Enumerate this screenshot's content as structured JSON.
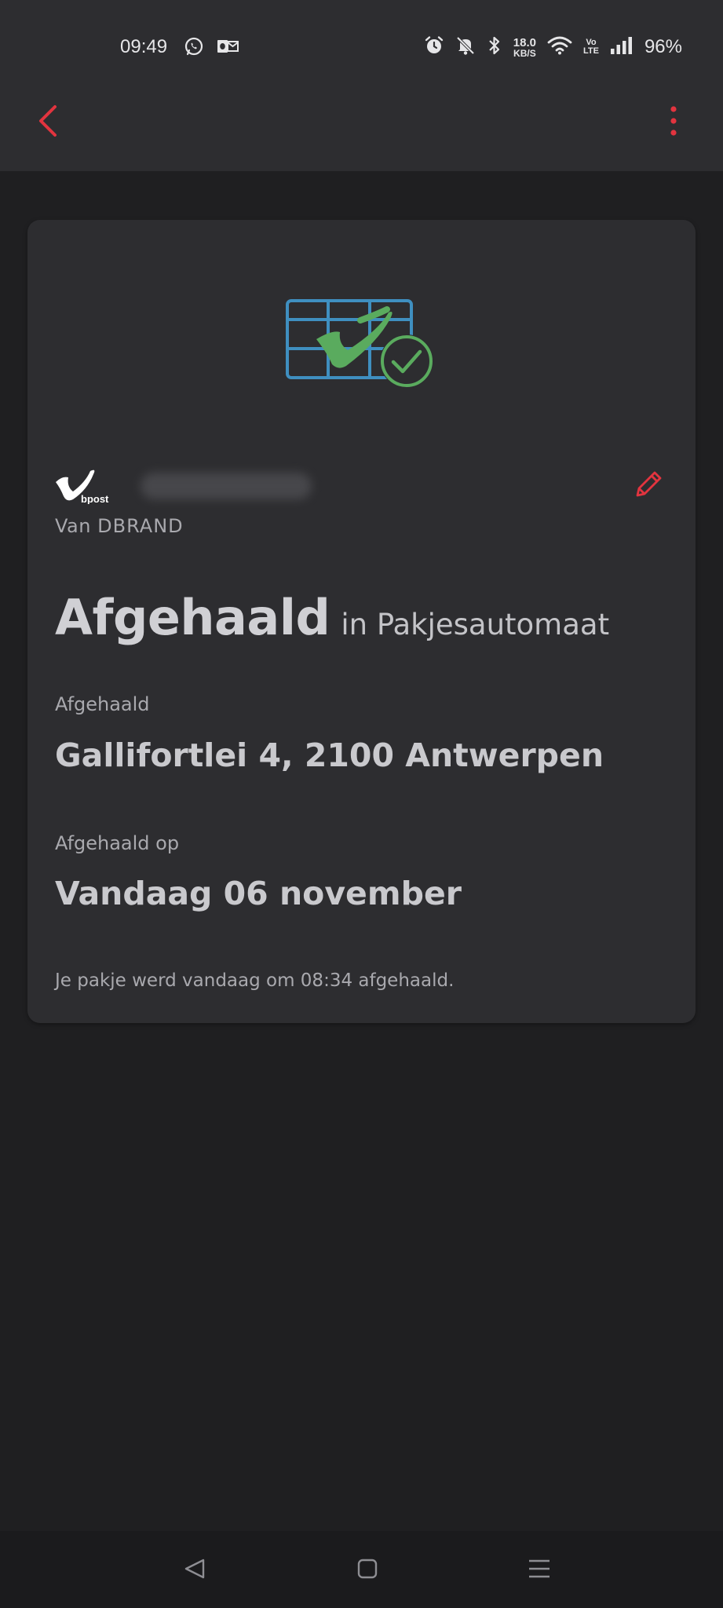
{
  "status_bar": {
    "time": "09:49",
    "left_icons": [
      "whatsapp-icon",
      "outlook-icon"
    ],
    "right_icons": [
      "alarm-icon",
      "bell-off-icon",
      "bluetooth-icon",
      "wifi-icon",
      "signal-icon"
    ],
    "network_speed_value": "18.0",
    "network_speed_unit": "KB/S",
    "volte_top": "Vo",
    "volte_bottom": "LTE",
    "battery": "96%"
  },
  "app_bar": {
    "back_icon": "chevron-left-icon",
    "menu_icon": "more-vertical-icon",
    "accent_color": "#e2343f"
  },
  "parcel": {
    "hero_icon": "parcel-locker-delivered-icon",
    "carrier_name": "bpost",
    "from_prefix": "Van",
    "sender": "DBRAND",
    "status": "Afgehaald",
    "status_location": "in Pakjesautomaat",
    "location_label": "Afgehaald",
    "location_value": "Gallifortlei 4, 2100 Antwerpen",
    "date_label": "Afgehaald op",
    "date_value": "Vandaag 06 november",
    "note": "Je pakje werd vandaag om 08:34 afgehaald.",
    "edit_icon": "pencil-icon"
  },
  "navigation_bar": {
    "back": "nav-back-icon",
    "home": "nav-home-icon",
    "recents": "nav-recents-icon"
  },
  "colors": {
    "locker_blue": "#3f8fc0",
    "check_green": "#5aab5e",
    "card_bg": "#2d2d30",
    "page_bg": "#1f1f21"
  }
}
